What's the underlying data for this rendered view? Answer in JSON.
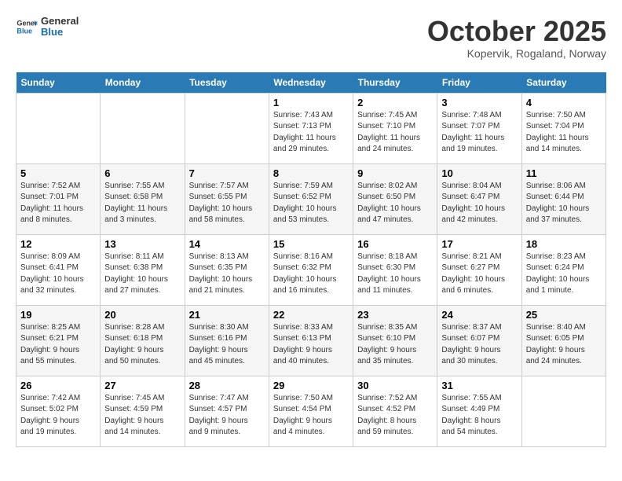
{
  "header": {
    "logo_general": "General",
    "logo_blue": "Blue",
    "month": "October 2025",
    "location": "Kopervik, Rogaland, Norway"
  },
  "weekdays": [
    "Sunday",
    "Monday",
    "Tuesday",
    "Wednesday",
    "Thursday",
    "Friday",
    "Saturday"
  ],
  "weeks": [
    [
      {
        "day": "",
        "info": ""
      },
      {
        "day": "",
        "info": ""
      },
      {
        "day": "",
        "info": ""
      },
      {
        "day": "1",
        "info": "Sunrise: 7:43 AM\nSunset: 7:13 PM\nDaylight: 11 hours\nand 29 minutes."
      },
      {
        "day": "2",
        "info": "Sunrise: 7:45 AM\nSunset: 7:10 PM\nDaylight: 11 hours\nand 24 minutes."
      },
      {
        "day": "3",
        "info": "Sunrise: 7:48 AM\nSunset: 7:07 PM\nDaylight: 11 hours\nand 19 minutes."
      },
      {
        "day": "4",
        "info": "Sunrise: 7:50 AM\nSunset: 7:04 PM\nDaylight: 11 hours\nand 14 minutes."
      }
    ],
    [
      {
        "day": "5",
        "info": "Sunrise: 7:52 AM\nSunset: 7:01 PM\nDaylight: 11 hours\nand 8 minutes."
      },
      {
        "day": "6",
        "info": "Sunrise: 7:55 AM\nSunset: 6:58 PM\nDaylight: 11 hours\nand 3 minutes."
      },
      {
        "day": "7",
        "info": "Sunrise: 7:57 AM\nSunset: 6:55 PM\nDaylight: 10 hours\nand 58 minutes."
      },
      {
        "day": "8",
        "info": "Sunrise: 7:59 AM\nSunset: 6:52 PM\nDaylight: 10 hours\nand 53 minutes."
      },
      {
        "day": "9",
        "info": "Sunrise: 8:02 AM\nSunset: 6:50 PM\nDaylight: 10 hours\nand 47 minutes."
      },
      {
        "day": "10",
        "info": "Sunrise: 8:04 AM\nSunset: 6:47 PM\nDaylight: 10 hours\nand 42 minutes."
      },
      {
        "day": "11",
        "info": "Sunrise: 8:06 AM\nSunset: 6:44 PM\nDaylight: 10 hours\nand 37 minutes."
      }
    ],
    [
      {
        "day": "12",
        "info": "Sunrise: 8:09 AM\nSunset: 6:41 PM\nDaylight: 10 hours\nand 32 minutes."
      },
      {
        "day": "13",
        "info": "Sunrise: 8:11 AM\nSunset: 6:38 PM\nDaylight: 10 hours\nand 27 minutes."
      },
      {
        "day": "14",
        "info": "Sunrise: 8:13 AM\nSunset: 6:35 PM\nDaylight: 10 hours\nand 21 minutes."
      },
      {
        "day": "15",
        "info": "Sunrise: 8:16 AM\nSunset: 6:32 PM\nDaylight: 10 hours\nand 16 minutes."
      },
      {
        "day": "16",
        "info": "Sunrise: 8:18 AM\nSunset: 6:30 PM\nDaylight: 10 hours\nand 11 minutes."
      },
      {
        "day": "17",
        "info": "Sunrise: 8:21 AM\nSunset: 6:27 PM\nDaylight: 10 hours\nand 6 minutes."
      },
      {
        "day": "18",
        "info": "Sunrise: 8:23 AM\nSunset: 6:24 PM\nDaylight: 10 hours\nand 1 minute."
      }
    ],
    [
      {
        "day": "19",
        "info": "Sunrise: 8:25 AM\nSunset: 6:21 PM\nDaylight: 9 hours\nand 55 minutes."
      },
      {
        "day": "20",
        "info": "Sunrise: 8:28 AM\nSunset: 6:18 PM\nDaylight: 9 hours\nand 50 minutes."
      },
      {
        "day": "21",
        "info": "Sunrise: 8:30 AM\nSunset: 6:16 PM\nDaylight: 9 hours\nand 45 minutes."
      },
      {
        "day": "22",
        "info": "Sunrise: 8:33 AM\nSunset: 6:13 PM\nDaylight: 9 hours\nand 40 minutes."
      },
      {
        "day": "23",
        "info": "Sunrise: 8:35 AM\nSunset: 6:10 PM\nDaylight: 9 hours\nand 35 minutes."
      },
      {
        "day": "24",
        "info": "Sunrise: 8:37 AM\nSunset: 6:07 PM\nDaylight: 9 hours\nand 30 minutes."
      },
      {
        "day": "25",
        "info": "Sunrise: 8:40 AM\nSunset: 6:05 PM\nDaylight: 9 hours\nand 24 minutes."
      }
    ],
    [
      {
        "day": "26",
        "info": "Sunrise: 7:42 AM\nSunset: 5:02 PM\nDaylight: 9 hours\nand 19 minutes."
      },
      {
        "day": "27",
        "info": "Sunrise: 7:45 AM\nSunset: 4:59 PM\nDaylight: 9 hours\nand 14 minutes."
      },
      {
        "day": "28",
        "info": "Sunrise: 7:47 AM\nSunset: 4:57 PM\nDaylight: 9 hours\nand 9 minutes."
      },
      {
        "day": "29",
        "info": "Sunrise: 7:50 AM\nSunset: 4:54 PM\nDaylight: 9 hours\nand 4 minutes."
      },
      {
        "day": "30",
        "info": "Sunrise: 7:52 AM\nSunset: 4:52 PM\nDaylight: 8 hours\nand 59 minutes."
      },
      {
        "day": "31",
        "info": "Sunrise: 7:55 AM\nSunset: 4:49 PM\nDaylight: 8 hours\nand 54 minutes."
      },
      {
        "day": "",
        "info": ""
      }
    ]
  ]
}
